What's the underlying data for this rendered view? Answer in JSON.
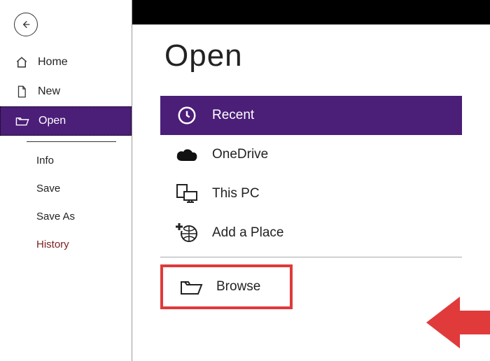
{
  "sidebar": {
    "items": [
      {
        "label": "Home"
      },
      {
        "label": "New"
      },
      {
        "label": "Open"
      }
    ],
    "sub": [
      {
        "label": "Info"
      },
      {
        "label": "Save"
      },
      {
        "label": "Save As"
      },
      {
        "label": "History"
      }
    ]
  },
  "main": {
    "title": "Open",
    "locations": [
      {
        "label": "Recent"
      },
      {
        "label": "OneDrive"
      },
      {
        "label": "This PC"
      },
      {
        "label": "Add a Place"
      },
      {
        "label": "Browse"
      }
    ]
  }
}
